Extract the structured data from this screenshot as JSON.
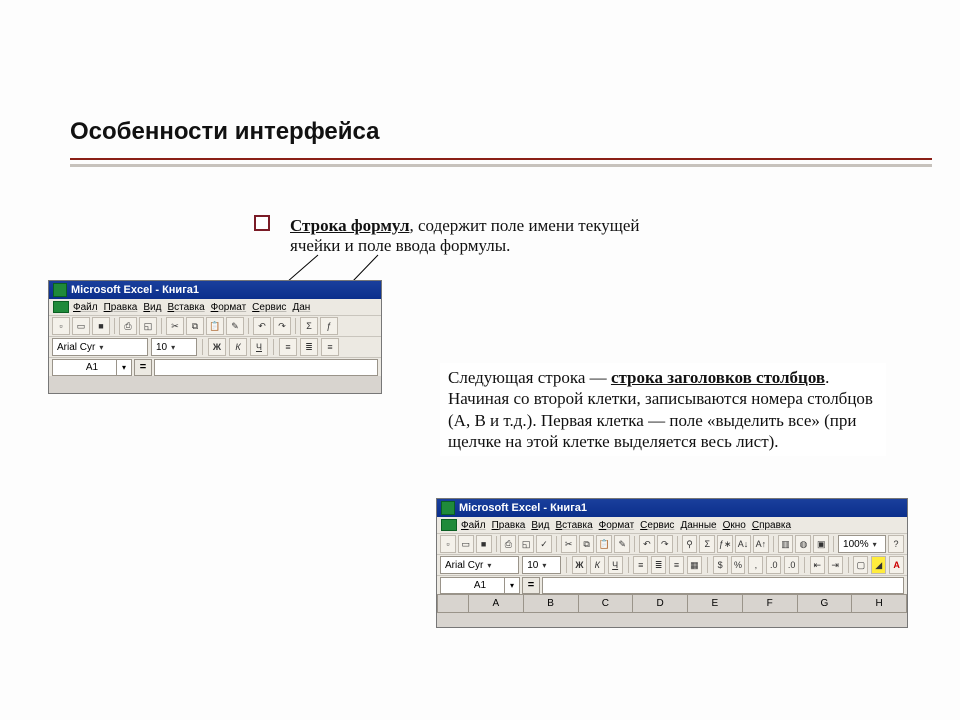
{
  "slide": {
    "title": "Особенности интерфейса"
  },
  "para1": {
    "lead": "Строка формул",
    "rest": ", содержит поле имени текущей ячейки и поле ввода формулы."
  },
  "para2": {
    "pre": "Следующая строка — ",
    "uline": "строка заголовков столбцов",
    "rest": ". Начиная со второй клетки, записываются номера столбцов (A, B и т.д.). Первая клетка — поле «выделить все» (при щелчке на этой клетке выделяется весь лист)."
  },
  "excel1": {
    "title": "Microsoft Excel - Книга1",
    "menus": [
      "Файл",
      "Правка",
      "Вид",
      "Вставка",
      "Формат",
      "Сервис",
      "Дан"
    ],
    "font": "Arial Cyr",
    "fontsize": "10",
    "cellref": "A1",
    "eq": "="
  },
  "excel2": {
    "title": "Microsoft Excel - Книга1",
    "menus": [
      "Файл",
      "Правка",
      "Вид",
      "Вставка",
      "Формат",
      "Сервис",
      "Данные",
      "Окно",
      "Справка"
    ],
    "font": "Arial Cyr",
    "fontsize": "10",
    "cellref": "A1",
    "eq": "=",
    "zoom": "100%",
    "columns": [
      "A",
      "B",
      "C",
      "D",
      "E",
      "F",
      "G",
      "H"
    ]
  },
  "glyphs": {
    "bold": "Ж",
    "italic": "К",
    "under": "Ч"
  }
}
